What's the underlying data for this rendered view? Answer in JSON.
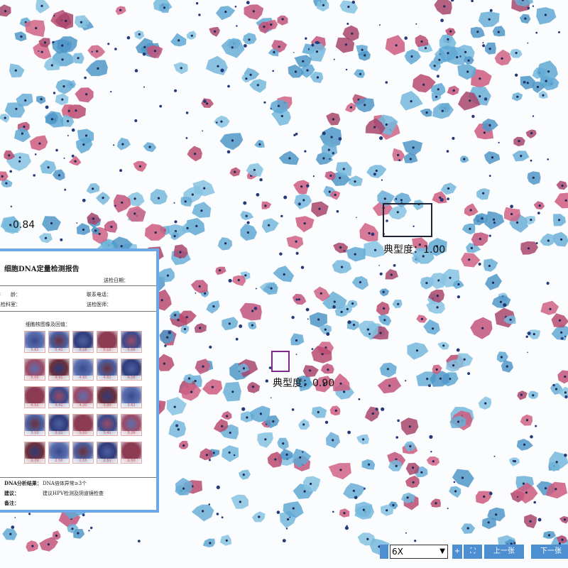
{
  "viewer": {
    "detections": [
      {
        "label": "0.84"
      },
      {
        "label": "典型度：1.00"
      },
      {
        "label": "典型度：0.90"
      }
    ]
  },
  "report": {
    "title": "细胞DNA定量检测报告",
    "send_date": "送检日期：",
    "fields": {
      "age": "年　　龄：",
      "phone": "联系电话：",
      "dept": "送检科室：",
      "doctor": "送检医师："
    },
    "image_section_title": "细胞核图像及回值：",
    "cell_values": [
      "5.61",
      "5.42",
      "5.16",
      "5.12",
      "5.06",
      "5.05",
      "4.91",
      "4.85",
      "4.82",
      "4.58",
      "4.51",
      "4.41",
      "4.30",
      "3.90",
      "3.82",
      "3.53",
      "3.51",
      "3.50",
      "3.41",
      "3.26",
      "2.79",
      "2.56",
      "2.55",
      "2.51",
      "2.50"
    ],
    "result_label": "DNA分析结果：",
    "result_value": "DNA倍体异常≥3个",
    "advice_label": "建议：",
    "advice_value": "建议HPV检测及阴道镜检查",
    "note_label": "备注："
  },
  "toolbar": {
    "zoom_value": "6X",
    "zoom_in_icon": "plus-icon",
    "fit_icon": "fullscreen-icon",
    "prev_label": "上一张",
    "next_label": "下一张"
  },
  "colors": {
    "accent": "#4e8fd1",
    "report_border": "#6ca8e6",
    "cyan_cell": "#66b3d6",
    "pink_cell": "#c8557a"
  }
}
